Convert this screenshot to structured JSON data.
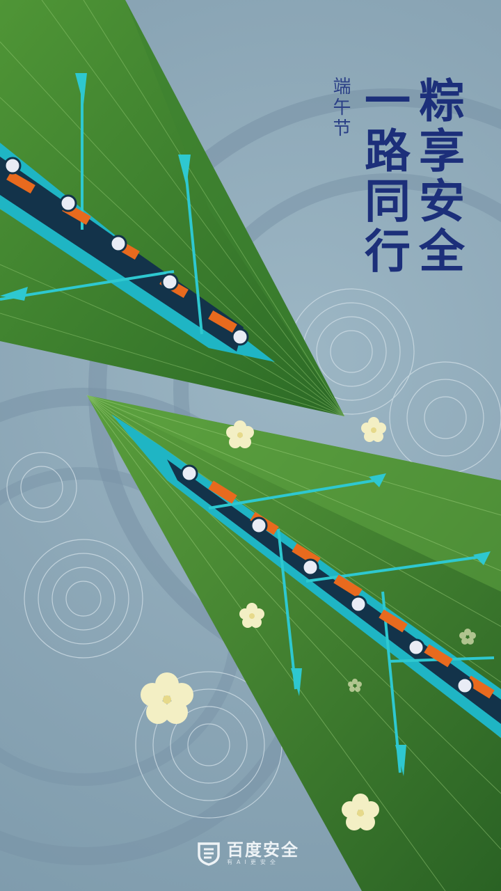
{
  "poster": {
    "title_col1": "粽享安全",
    "title_col2": "一路同行",
    "festival": "端午节"
  },
  "brand": {
    "name": "百度安全",
    "slogan": "有AI更安全",
    "logo_icon": "shield-icon"
  },
  "colors": {
    "background": "#8fa9b8",
    "leaf_dark": "#2f6e2a",
    "leaf_light": "#5a9a3a",
    "boat": "#1fb5c4",
    "oar": "#2ec8d0",
    "rower_body": "#e86a1e",
    "title": "#1c2f7a",
    "flower": "#f3efc4"
  }
}
